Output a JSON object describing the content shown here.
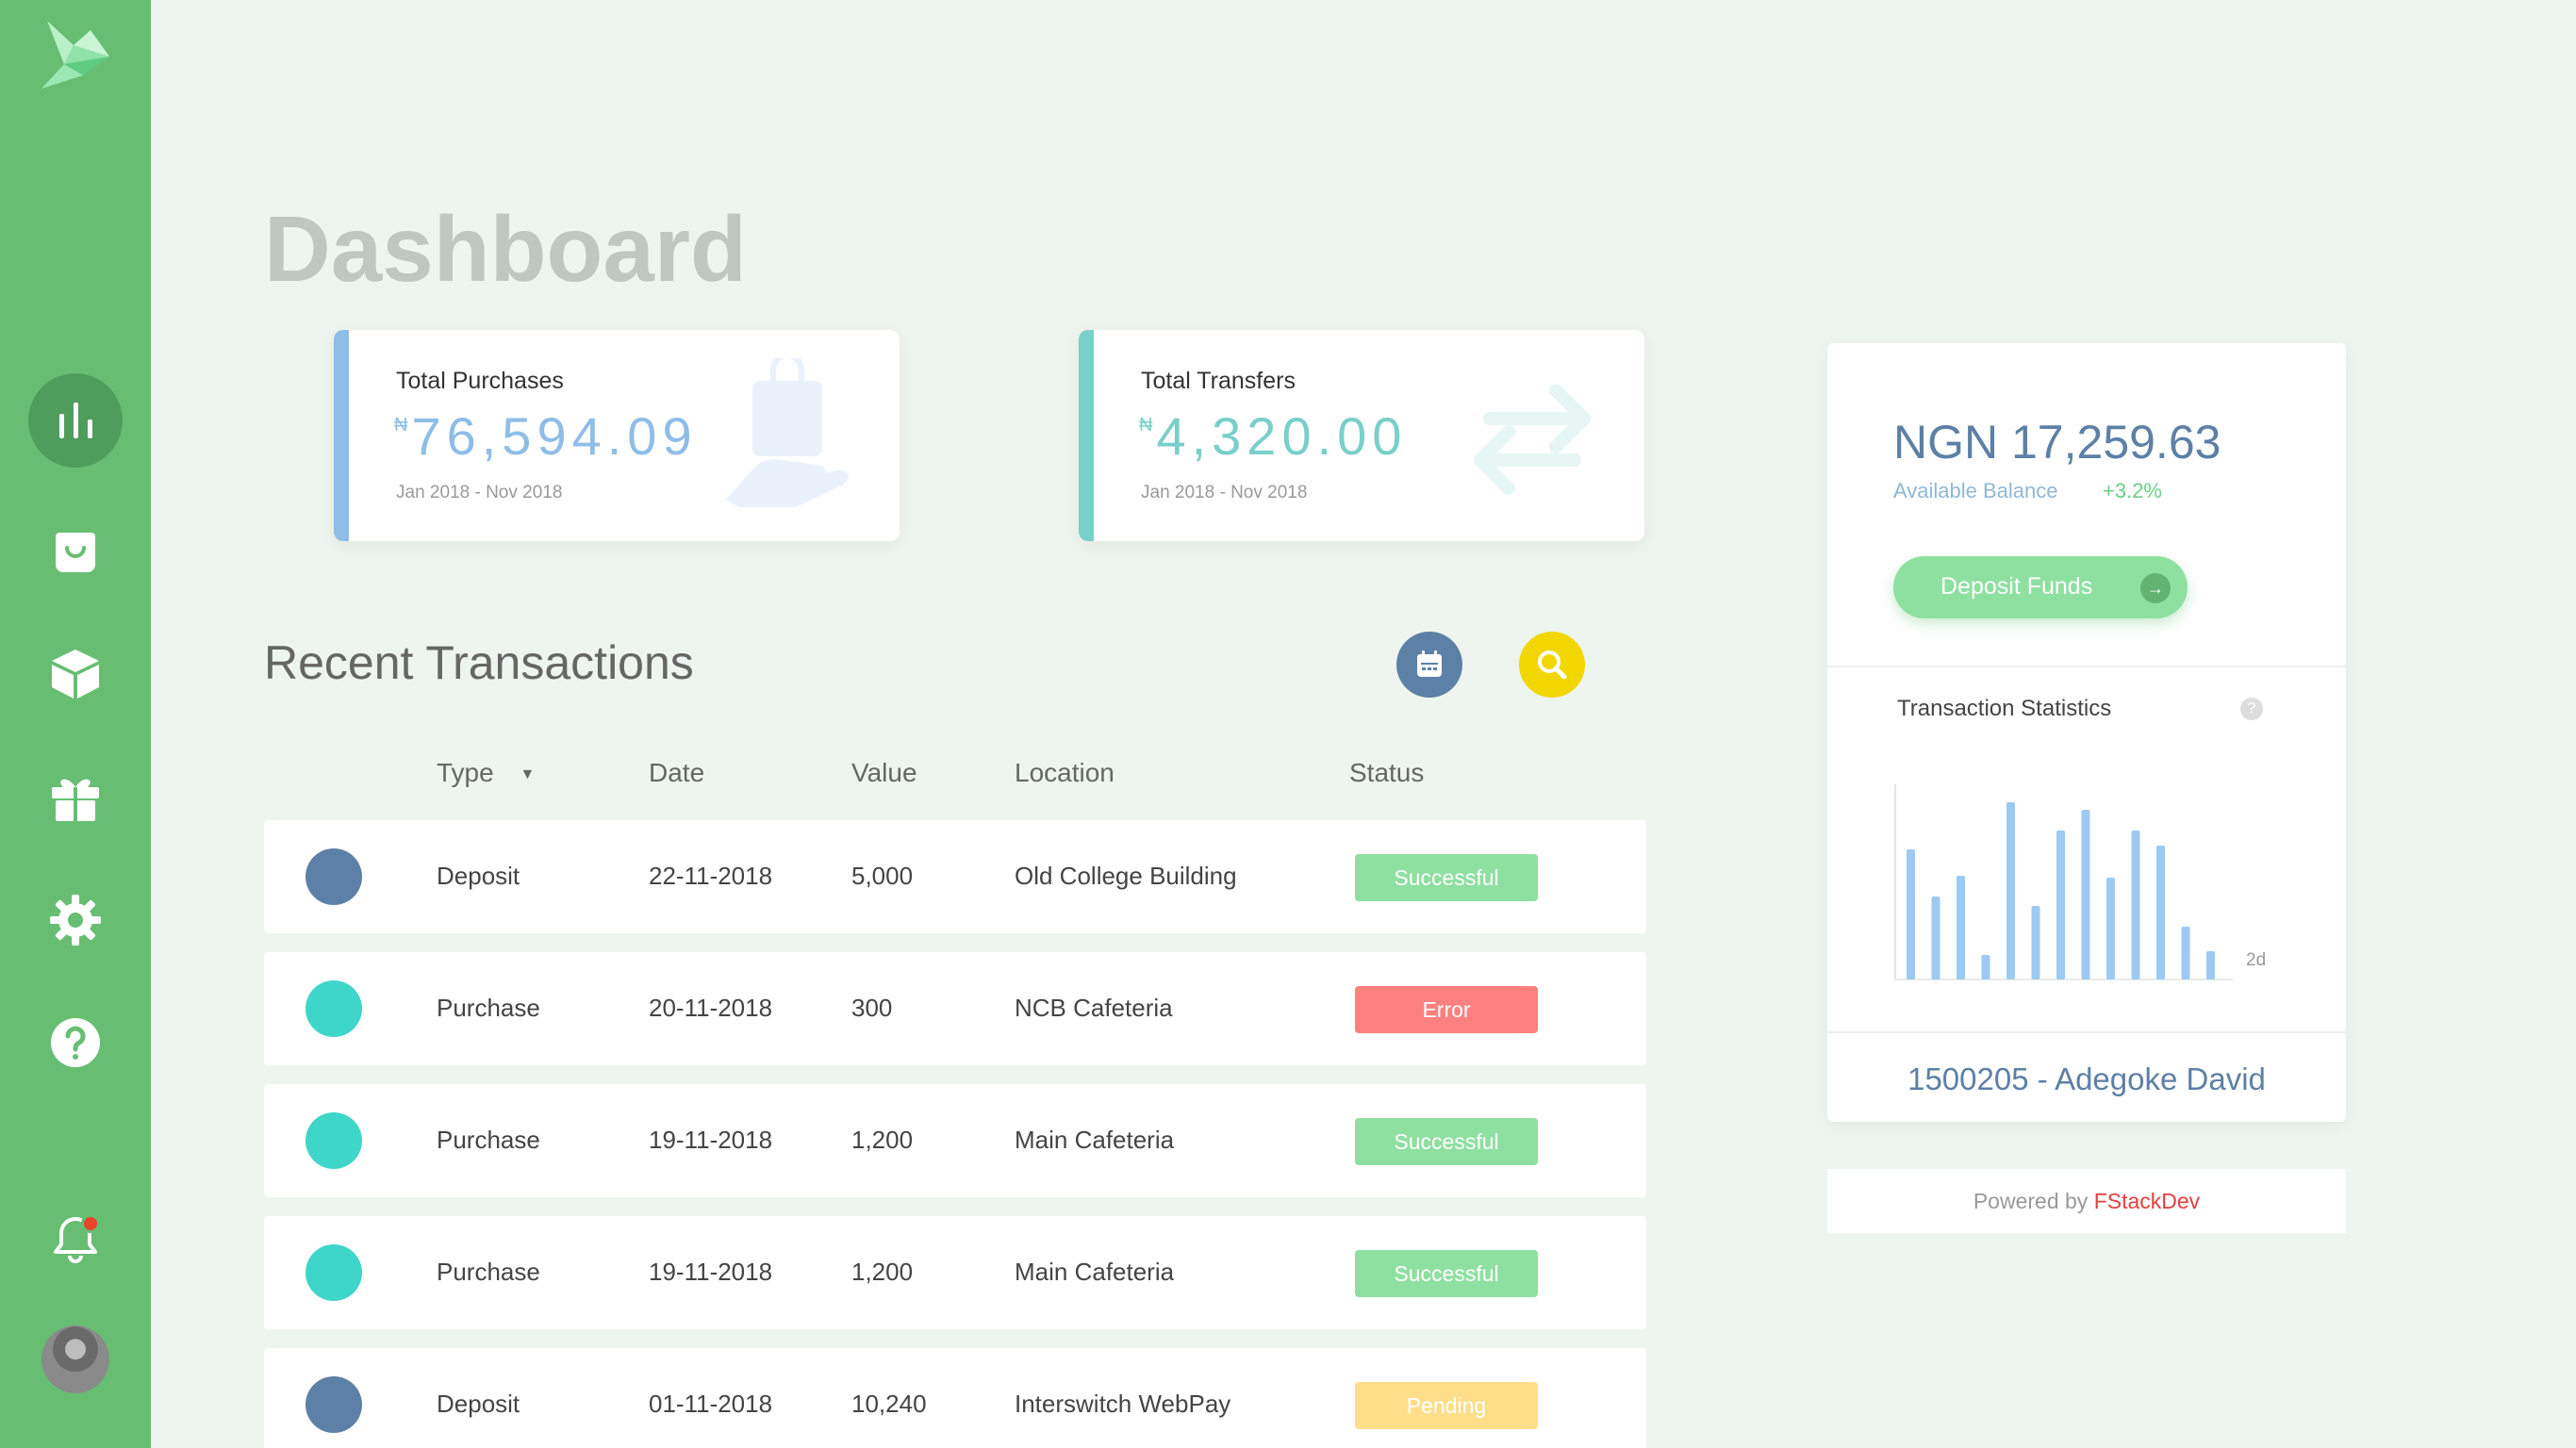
{
  "sidebar": {
    "items": [
      {
        "name": "dashboard",
        "icon": "bar-chart-icon",
        "active": true
      },
      {
        "name": "purchases",
        "icon": "shopping-bag-icon",
        "active": false
      },
      {
        "name": "products",
        "icon": "box-icon",
        "active": false
      },
      {
        "name": "gifts",
        "icon": "gift-icon",
        "active": false
      },
      {
        "name": "settings",
        "icon": "gear-icon",
        "active": false
      },
      {
        "name": "help",
        "icon": "help-icon",
        "active": false
      }
    ],
    "notification_icon": "bell-icon",
    "has_unread_notification": true
  },
  "page": {
    "title": "Dashboard"
  },
  "stats": {
    "purchases": {
      "label": "Total Purchases",
      "currency_symbol": "₦",
      "amount": "76,594.09",
      "period": "Jan 2018 - Nov 2018",
      "accent": "#8fbde8",
      "icon": "hand-bag-icon"
    },
    "transfers": {
      "label": "Total Transfers",
      "currency_symbol": "₦",
      "amount": "4,320.00",
      "period": "Jan 2018 - Nov 2018",
      "accent": "#79d0c8",
      "icon": "transfer-arrows-icon"
    }
  },
  "transactions": {
    "title": "Recent Transactions",
    "headers": {
      "type": "Type",
      "date": "Date",
      "value": "Value",
      "location": "Location",
      "status": "Status"
    },
    "rows": [
      {
        "type": "Deposit",
        "date": "22-11-2018",
        "value": "5,000",
        "location": "Old College Building",
        "status": "Successful",
        "dot": "#5d80a6",
        "badge": "#8ee0a0"
      },
      {
        "type": "Purchase",
        "date": "20-11-2018",
        "value": "300",
        "location": "NCB Cafeteria",
        "status": "Error",
        "dot": "#3ed6c8",
        "badge": "#ff8080"
      },
      {
        "type": "Purchase",
        "date": "19-11-2018",
        "value": "1,200",
        "location": "Main Cafeteria",
        "status": "Successful",
        "dot": "#3ed6c8",
        "badge": "#8ee0a0"
      },
      {
        "type": "Purchase",
        "date": "19-11-2018",
        "value": "1,200",
        "location": "Main Cafeteria",
        "status": "Successful",
        "dot": "#3ed6c8",
        "badge": "#8ee0a0"
      },
      {
        "type": "Deposit",
        "date": "01-11-2018",
        "value": "10,240",
        "location": "Interswitch WebPay",
        "status": "Pending",
        "dot": "#5d80a6",
        "badge": "#ffde8a"
      }
    ]
  },
  "balance": {
    "amount": "NGN 17,259.63",
    "label": "Available Balance",
    "change": "+3.2%",
    "deposit_label": "Deposit Funds",
    "deposit_arrow": "→",
    "stats_title": "Transaction Statistics",
    "help_mark": "?",
    "account": "1500205 - Adegoke David"
  },
  "chart_data": {
    "type": "bar",
    "values": [
      0.69,
      0.44,
      0.55,
      0.13,
      0.94,
      0.39,
      0.79,
      0.9,
      0.54,
      0.79,
      0.71,
      0.28,
      0.15
    ],
    "x_tick_label": "2d",
    "color": "#9ccaf2"
  },
  "footer": {
    "prefix": "Powered by ",
    "brand": "FStackDev"
  }
}
